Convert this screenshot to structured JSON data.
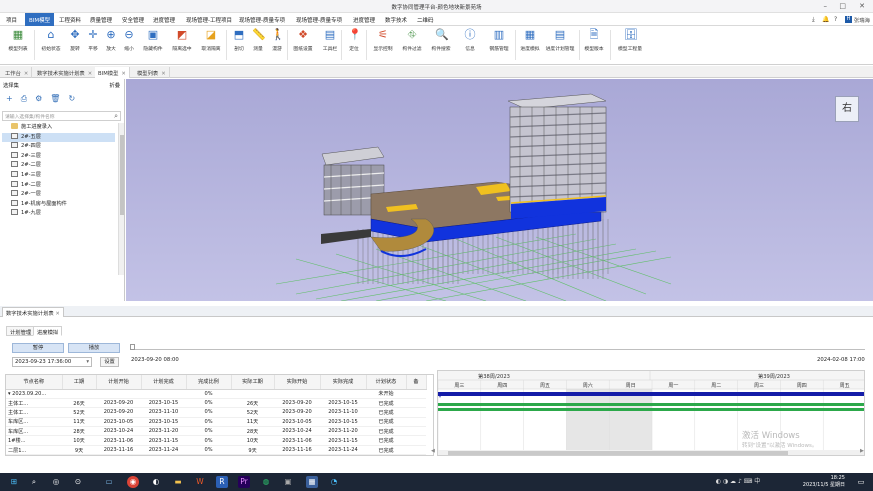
{
  "window": {
    "title": "数字协同管理平台-颜色地块新景苑场",
    "controls": [
      "–",
      "□",
      "✕"
    ]
  },
  "menu": {
    "items": [
      "项目",
      "BIM模型",
      "工程资料",
      "质量管理",
      "安全管理",
      "进度管理",
      "现场管理-工程项目",
      "现场管理-质量专项",
      "现场管理-质量专项",
      "进度管理",
      "数字技术",
      "二维码"
    ],
    "active_index": 1,
    "user": "张瑞海"
  },
  "ribbon": {
    "buttons": [
      {
        "label": "模型列表",
        "icon": "model-list-icon"
      },
      {
        "label": "初始状态",
        "icon": "home-icon"
      },
      {
        "label": "旋转",
        "icon": "rotate-icon"
      },
      {
        "label": "平移",
        "icon": "pan-icon"
      },
      {
        "label": "放大",
        "icon": "zoom-in-icon"
      },
      {
        "label": "缩小",
        "icon": "zoom-out-icon"
      },
      {
        "label": "隐藏构件",
        "icon": "hide-component-icon"
      },
      {
        "label": "隔离选中",
        "icon": "isolate-icon"
      },
      {
        "label": "取消隔离",
        "icon": "unisolate-icon"
      },
      {
        "label": "剖切",
        "icon": "section-icon"
      },
      {
        "label": "测量",
        "icon": "measure-icon"
      },
      {
        "label": "漫游",
        "icon": "walk-icon"
      },
      {
        "label": "图纸设置",
        "icon": "drawing-settings-icon"
      },
      {
        "label": "工具栏",
        "icon": "toolbar-icon"
      },
      {
        "label": "定位",
        "icon": "locate-icon"
      },
      {
        "label": "显示控制",
        "icon": "display-control-icon"
      },
      {
        "label": "构件过滤",
        "icon": "component-filter-icon"
      },
      {
        "label": "构件搜索",
        "icon": "component-search-icon"
      },
      {
        "label": "信息",
        "icon": "info-icon"
      },
      {
        "label": "钢筋管理",
        "icon": "rebar-icon"
      },
      {
        "label": "进度模拟",
        "icon": "schedule-sim-icon"
      },
      {
        "label": "进度计划管理",
        "icon": "schedule-plan-icon"
      },
      {
        "label": "模型版本",
        "icon": "model-version-icon"
      },
      {
        "label": "模型工程量",
        "icon": "model-quantity-icon"
      }
    ]
  },
  "doc_tabs": [
    {
      "label": "工作台",
      "active": false
    },
    {
      "label": "数字技术实施计划表",
      "active": false
    },
    {
      "label": "BIM模型",
      "active": true
    },
    {
      "label": "模型列表",
      "active": false
    }
  ],
  "left_panel": {
    "title": "选择集",
    "collapse_label": "折叠",
    "search_placeholder": "请输入选择集/构件名称",
    "tree": [
      {
        "label": "施工进度录入",
        "type": "folder",
        "selected": false
      },
      {
        "label": "2#-五层",
        "type": "layer",
        "selected": true
      },
      {
        "label": "2#-四层",
        "type": "layer",
        "selected": false
      },
      {
        "label": "2#-三层",
        "type": "layer",
        "selected": false
      },
      {
        "label": "2#-二层",
        "type": "layer",
        "selected": false
      },
      {
        "label": "1#-三层",
        "type": "layer",
        "selected": false
      },
      {
        "label": "1#-二层",
        "type": "layer",
        "selected": false
      },
      {
        "label": "2#-一层",
        "type": "layer",
        "selected": false
      },
      {
        "label": "1#-机房与屋面构件",
        "type": "layer",
        "selected": false
      },
      {
        "label": "1#-九层",
        "type": "layer",
        "selected": false
      }
    ]
  },
  "viewport": {
    "view_cube_label": "右"
  },
  "bottom_panel": {
    "tab_label": "数字技术实施计划表",
    "subtabs": [
      "计划管理",
      "进度模拟"
    ],
    "active_subtab": 1,
    "play_button": "播放",
    "stop_button": "暂停",
    "date_value": "2023-09-23 17:36:00",
    "set_button": "设置",
    "slider_start": "2023-09-20 08:00",
    "slider_end": "2024-02-08 17:00",
    "table": {
      "headers": [
        "节点名称",
        "工期",
        "计划开始",
        "计划完成",
        "完成比例",
        "实际工期",
        "实际开始",
        "实际完成",
        "计划状态"
      ],
      "rows": [
        [
          "2023.09.20...",
          "",
          "",
          "",
          "0%",
          "",
          "",
          "",
          "未开始"
        ],
        [
          "主体工...",
          "26天",
          "2023-09-20",
          "2023-10-15",
          "0%",
          "26天",
          "2023-09-20",
          "2023-10-15",
          "已完成"
        ],
        [
          "主体工...",
          "52天",
          "2023-09-20",
          "2023-11-10",
          "0%",
          "52天",
          "2023-09-20",
          "2023-11-10",
          "已完成"
        ],
        [
          "车库区...",
          "11天",
          "2023-10-05",
          "2023-10-15",
          "0%",
          "11天",
          "2023-10-05",
          "2023-10-15",
          "已完成"
        ],
        [
          "车库区...",
          "28天",
          "2023-10-24",
          "2023-11-20",
          "0%",
          "28天",
          "2023-10-24",
          "2023-11-20",
          "已完成"
        ],
        [
          "1#楼...",
          "10天",
          "2023-11-06",
          "2023-11-15",
          "0%",
          "10天",
          "2023-11-06",
          "2023-11-15",
          "已完成"
        ],
        [
          "二层1...",
          "9天",
          "2023-11-16",
          "2023-11-24",
          "0%",
          "9天",
          "2023-11-16",
          "2023-11-24",
          "已完成"
        ]
      ]
    },
    "gantt": {
      "weeks": [
        "第38周/2023",
        "第39周/2023"
      ],
      "days": [
        "周三",
        "周四",
        "周五",
        "周六",
        "周日",
        "周一",
        "周二",
        "周三",
        "周四",
        "周五"
      ],
      "bar_colors": {
        "navy": "#141ca8",
        "green": "#2ca84a"
      }
    }
  },
  "watermark": {
    "line1": "激活 Windows",
    "line2": "转到\"设置\"以激活 Windows。"
  },
  "taskbar": {
    "icons": [
      "start-icon",
      "search-icon",
      "task-view-icon",
      "chrome-icon",
      "edge-icon",
      "file-explorer-icon",
      "word-icon",
      "wps-icon",
      "revit-icon",
      "premiere-icon",
      "wechat-icon",
      "qq-icon",
      "app-icon",
      "app-icon-2"
    ],
    "time": "18:25",
    "date": "2023/11/5 星期日"
  }
}
